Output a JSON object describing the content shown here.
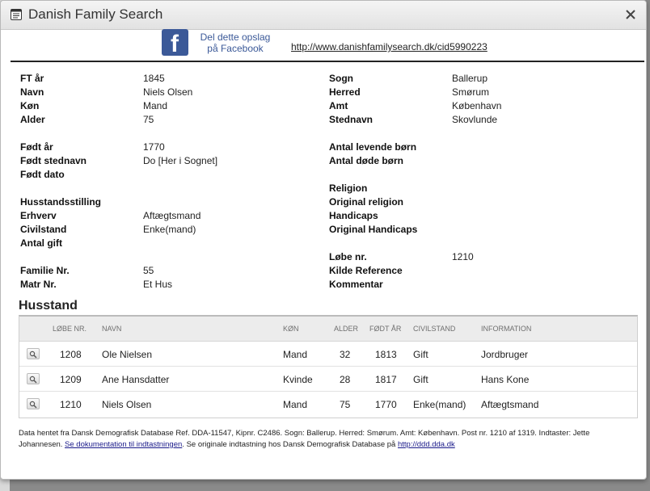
{
  "window": {
    "title": "Danish Family Search"
  },
  "share": {
    "facebook_line1": "Del dette opslag",
    "facebook_line2": "på Facebook",
    "url": "http://www.danishfamilysearch.dk/cid5990223"
  },
  "details_left": [
    {
      "label": "FT år",
      "value": "1845"
    },
    {
      "label": "Navn",
      "value": "Niels Olsen"
    },
    {
      "label": "Køn",
      "value": "Mand"
    },
    {
      "label": "Alder",
      "value": "75"
    },
    {
      "label": "Født år",
      "value": "1770"
    },
    {
      "label": "Født stednavn",
      "value": "Do [Her i Sognet]"
    },
    {
      "label": "Født dato",
      "value": ""
    },
    {
      "label": "Husstandsstilling",
      "value": ""
    },
    {
      "label": "Erhverv",
      "value": "Aftægtsmand"
    },
    {
      "label": "Civilstand",
      "value": "Enke(mand)"
    },
    {
      "label": "Antal gift",
      "value": ""
    },
    {
      "label": "Familie Nr.",
      "value": "55"
    },
    {
      "label": "Matr Nr.",
      "value": "Et Hus"
    }
  ],
  "details_right": [
    {
      "label": "Sogn",
      "value": "Ballerup"
    },
    {
      "label": "Herred",
      "value": "Smørum"
    },
    {
      "label": "Amt",
      "value": "København"
    },
    {
      "label": "Stednavn",
      "value": "Skovlunde"
    },
    {
      "label": "Antal levende børn",
      "value": ""
    },
    {
      "label": "Antal døde børn",
      "value": ""
    },
    {
      "label": "Religion",
      "value": ""
    },
    {
      "label": "Original religion",
      "value": ""
    },
    {
      "label": "Handicaps",
      "value": ""
    },
    {
      "label": "Original Handicaps",
      "value": ""
    },
    {
      "label": "Løbe nr.",
      "value": "1210"
    },
    {
      "label": "Kilde Reference",
      "value": ""
    },
    {
      "label": "Kommentar",
      "value": ""
    }
  ],
  "household": {
    "title": "Husstand",
    "columns": [
      "LØBE NR.",
      "NAVN",
      "KØN",
      "ALDER",
      "FØDT ÅR",
      "CIVILSTAND",
      "INFORMATION"
    ],
    "rows": [
      [
        "1208",
        "Ole Nielsen",
        "Mand",
        "32",
        "1813",
        "Gift",
        "Jordbruger"
      ],
      [
        "1209",
        "Ane Hansdatter",
        "Kvinde",
        "28",
        "1817",
        "Gift",
        "Hans Kone"
      ],
      [
        "1210",
        "Niels Olsen",
        "Mand",
        "75",
        "1770",
        "Enke(mand)",
        "Aftægtsmand"
      ]
    ]
  },
  "footnote": {
    "text1": "Data hentet fra Dansk Demografisk Database Ref. DDA-11547, Kipnr. C2486. Sogn: Ballerup. Herred: Smørum. Amt: København. Post nr. 1210 af 1319. Indtaster: Jette Johannesen. ",
    "link1": "Se dokumentation til indtastningen",
    "text2": ". Se originale indtastning hos Dansk Demografisk Database på ",
    "link2": "http://ddd.dda.dk"
  },
  "colors": {
    "facebook": "#3b5998",
    "header_bg": "#ececec"
  },
  "icons": {
    "title": "document-icon",
    "close": "close-icon",
    "row_action": "magnifier-icon"
  }
}
